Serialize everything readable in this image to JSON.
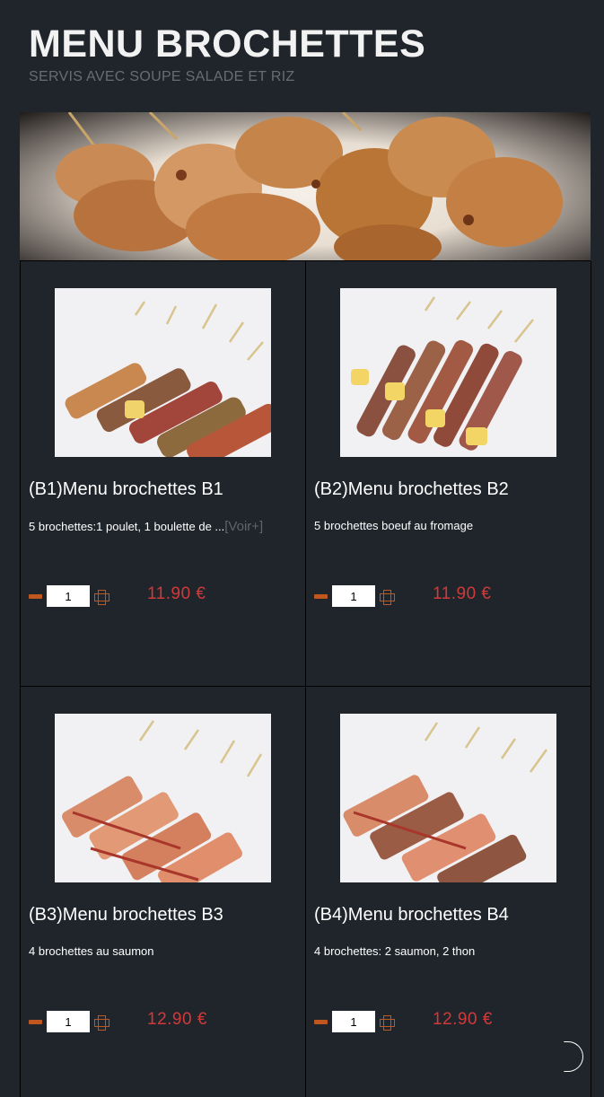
{
  "header": {
    "title": "MENU BROCHETTES",
    "subtitle": "SERVIS AVEC SOUPE SALADE ET RIZ"
  },
  "banner": {
    "alt": "brochettes-photo"
  },
  "items": [
    {
      "name": "(B1)Menu brochettes B1",
      "desc": "5 brochettes:1 poulet, 1 boulette de ...",
      "more": "[Voir+]",
      "qty": "1",
      "price": "11.90 €"
    },
    {
      "name": "(B2)Menu brochettes B2",
      "desc": "5 brochettes boeuf au fromage",
      "more": "",
      "qty": "1",
      "price": "11.90 €"
    },
    {
      "name": "(B3)Menu brochettes B3",
      "desc": "4 brochettes au saumon",
      "more": "",
      "qty": "1",
      "price": "12.90 €"
    },
    {
      "name": "(B4)Menu brochettes B4",
      "desc": "4 brochettes: 2 saumon, 2 thon",
      "more": "",
      "qty": "1",
      "price": "12.90 €"
    }
  ],
  "colors": {
    "background": "#1f252b",
    "price": "#d23a3a",
    "qty_controls": "#c0571f",
    "subtitle": "#666d73"
  }
}
